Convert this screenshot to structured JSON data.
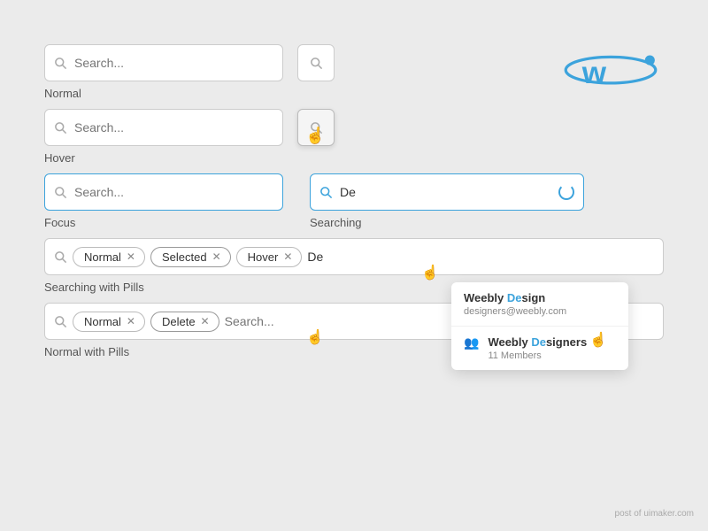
{
  "logo": {
    "alt": "Weebly logo"
  },
  "sections": {
    "normal": {
      "label": "Normal",
      "search_placeholder": "Search..."
    },
    "hover": {
      "label": "Hover",
      "search_placeholder": "Search..."
    },
    "focus": {
      "label": "Focus",
      "search_placeholder": "Search..."
    },
    "searching": {
      "label": "Searching",
      "input_value": "De"
    },
    "searching_with_pills": {
      "label": "Searching with Pills",
      "pills": [
        {
          "label": "Normal",
          "state": "normal"
        },
        {
          "label": "Selected",
          "state": "selected"
        },
        {
          "label": "Hover",
          "state": "hover"
        }
      ],
      "input_value": "De"
    },
    "normal_with_pills": {
      "label": "Normal with Pills",
      "pills": [
        {
          "label": "Normal",
          "state": "normal"
        },
        {
          "label": "Delete",
          "state": "delete"
        }
      ],
      "search_placeholder": "Search..."
    }
  },
  "dropdown": {
    "items": [
      {
        "title_prefix": "Weebly ",
        "title_highlight": "De",
        "title_suffix": "sign",
        "subtitle": "designers@weebly.com",
        "type": "user"
      },
      {
        "title_prefix": "Weebly ",
        "title_highlight": "De",
        "title_suffix": "signers",
        "subtitle": "11 Members",
        "type": "group"
      }
    ]
  },
  "footer": {
    "text": "post of uimaker.com"
  }
}
